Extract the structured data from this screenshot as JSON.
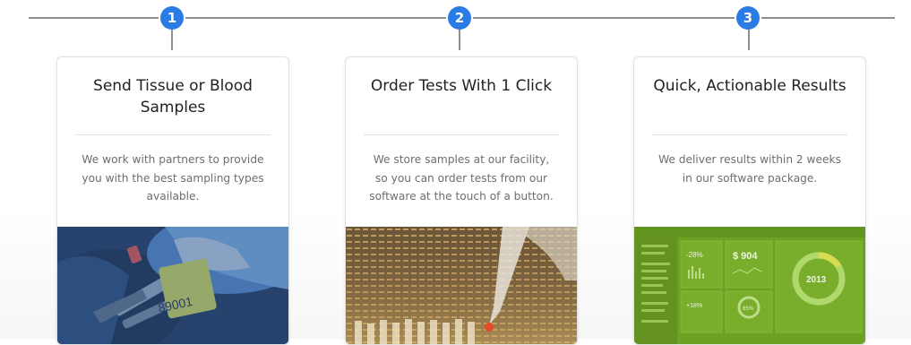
{
  "steps": [
    {
      "number": "1",
      "title": "Send Tissue or Blood Samples",
      "description": "We work with partners to provide you with the best sampling types available.",
      "image": "cattle-ear-tag-sampling",
      "tag_text": "89001"
    },
    {
      "number": "2",
      "title": "Order Tests With 1 Click",
      "description": "We store samples at our facility, so you can order tests from our software at the touch of a button.",
      "image": "lab-pipette-gel"
    },
    {
      "number": "3",
      "title": "Quick, Actionable Results",
      "description": "We deliver results within 2 weeks in our software package.",
      "image": "software-dashboard",
      "dashboard": {
        "stat_a": "-28%",
        "stat_b": "$ 904",
        "stat_c": "+18%",
        "ring_small": "65%",
        "ring_year": "2013"
      }
    }
  ],
  "colors": {
    "badge": "#2a7be4",
    "line": "#8f8f8f",
    "image1_tint": "#2f5f9e",
    "image2_tint": "#a27b3a",
    "dashboard_green": "#7db52a"
  }
}
